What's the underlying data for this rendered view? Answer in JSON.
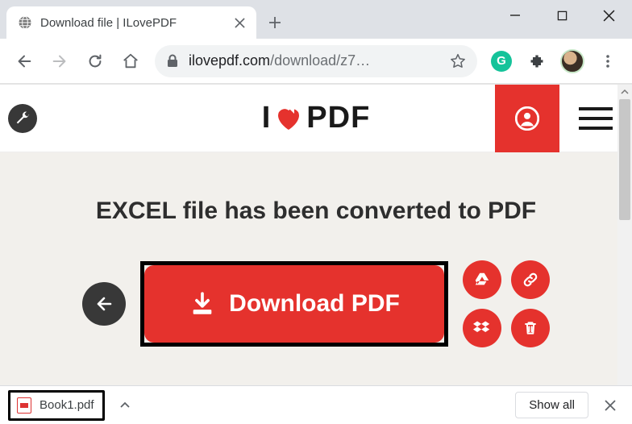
{
  "window": {
    "tab_title": "Download file | ILovePDF"
  },
  "toolbar": {
    "url_host": "ilovepdf.com",
    "url_path": "/download/z7…"
  },
  "site": {
    "logo_left": "I",
    "logo_right": "PDF",
    "headline": "EXCEL file has been converted to PDF",
    "download_label": "Download PDF"
  },
  "downloads": {
    "item_name": "Book1.pdf",
    "show_all": "Show all"
  },
  "colors": {
    "brand_red": "#e5322d",
    "page_bg": "#f2f0ec"
  }
}
